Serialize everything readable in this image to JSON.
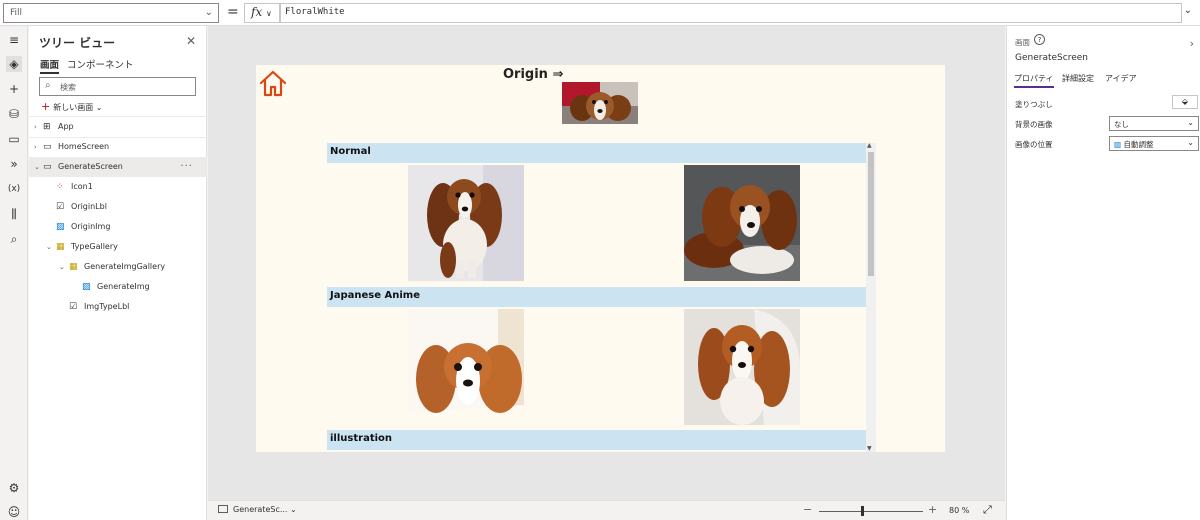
{
  "formula_bar": {
    "property": "Fill",
    "equals": "=",
    "fx_label": "fx",
    "chevron": "∨",
    "formula": "FloralWhite"
  },
  "rail": {
    "icons": [
      "hamburger-icon",
      "layers-icon",
      "add-icon",
      "data-icon",
      "media-icon",
      "power-automate-icon",
      "variables-icon",
      "tools-icon",
      "search-icon",
      "settings-icon",
      "account-icon"
    ],
    "variables_label": "(x)"
  },
  "tree": {
    "title": "ツリー ビュー",
    "tabs": [
      "画面",
      "コンポーネント"
    ],
    "search_placeholder": "検索",
    "new_screen": "新しい画面",
    "items": [
      {
        "label": "App"
      },
      {
        "label": "HomeScreen"
      },
      {
        "label": "GenerateScreen"
      },
      {
        "label": "Icon1"
      },
      {
        "label": "OriginLbl"
      },
      {
        "label": "OriginImg"
      },
      {
        "label": "TypeGallery"
      },
      {
        "label": "GenerateImgGallery"
      },
      {
        "label": "GenerateImg"
      },
      {
        "label": "ImgTypeLbl"
      }
    ],
    "more": "···"
  },
  "screen": {
    "background": "#FFFAF0",
    "origin_label": "Origin ⇒",
    "gallery_rows": [
      {
        "type": "Normal"
      },
      {
        "type": "Japanese Anime"
      },
      {
        "type": "illustration"
      }
    ]
  },
  "statusbar": {
    "screen_name": "GenerateSc...",
    "zoom_minus": "−",
    "zoom_plus": "+",
    "zoom_value": "80",
    "zoom_unit": "%",
    "zoom_level": 0.4
  },
  "props": {
    "type_label": "画面",
    "help": "?",
    "screen_name": "GenerateScreen",
    "tabs": [
      "プロパティ",
      "詳細設定",
      "アイデア"
    ],
    "rows": [
      {
        "label": "塗りつぶし"
      },
      {
        "label": "背景の画像",
        "value": "なし"
      },
      {
        "label": "画像の位置",
        "value": "自動調整"
      }
    ],
    "accent": "#5C2D91"
  }
}
